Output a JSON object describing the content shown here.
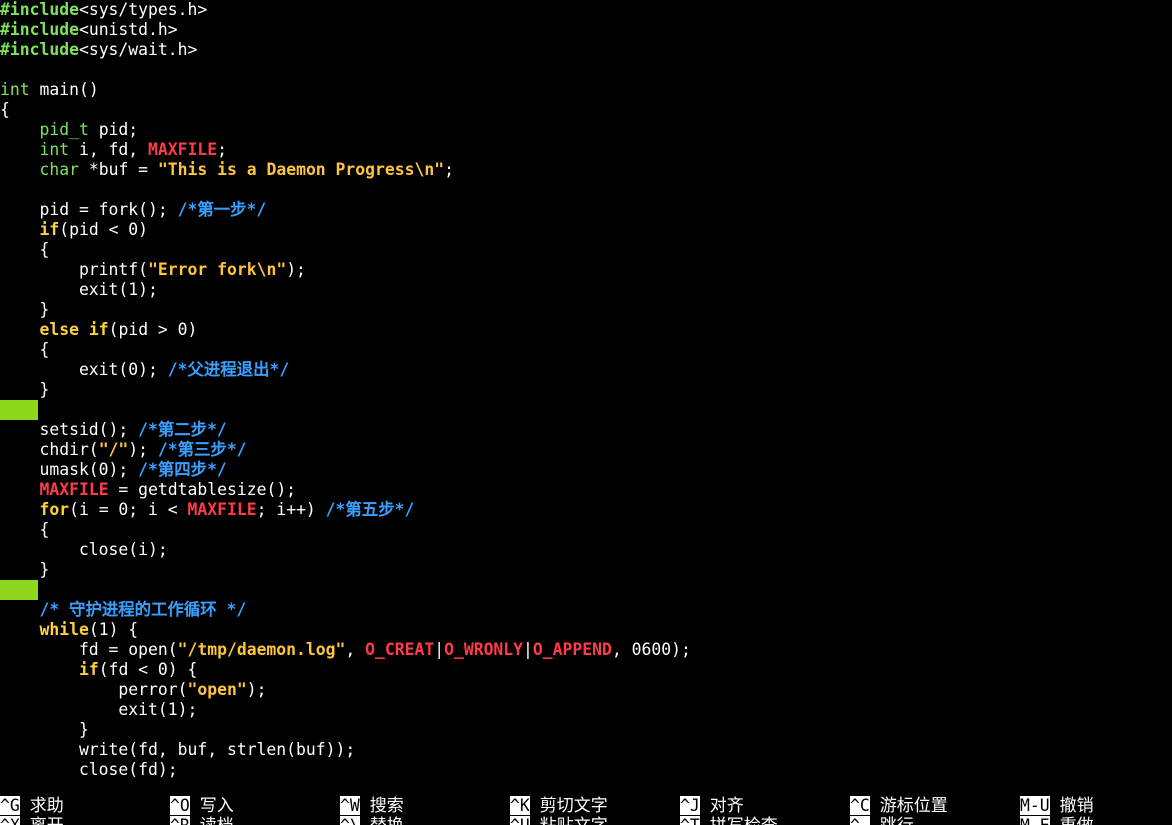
{
  "editor": {
    "lines": [
      {
        "tokens": [
          {
            "t": "#include",
            "c": "pre"
          },
          {
            "t": "<sys/types.h>",
            "c": "plain"
          }
        ]
      },
      {
        "tokens": [
          {
            "t": "#include",
            "c": "pre"
          },
          {
            "t": "<unistd.h>",
            "c": "plain"
          }
        ]
      },
      {
        "tokens": [
          {
            "t": "#include",
            "c": "pre"
          },
          {
            "t": "<sys/wait.h>",
            "c": "plain"
          }
        ]
      },
      {
        "tokens": []
      },
      {
        "tokens": [
          {
            "t": "int",
            "c": "type"
          },
          {
            "t": " main()",
            "c": "plain"
          }
        ]
      },
      {
        "tokens": [
          {
            "t": "{",
            "c": "plain"
          }
        ]
      },
      {
        "tokens": [
          {
            "t": "    ",
            "c": "plain"
          },
          {
            "t": "pid_t",
            "c": "type"
          },
          {
            "t": " pid;",
            "c": "plain"
          }
        ]
      },
      {
        "tokens": [
          {
            "t": "    ",
            "c": "plain"
          },
          {
            "t": "int",
            "c": "type"
          },
          {
            "t": " i, fd, ",
            "c": "plain"
          },
          {
            "t": "MAXFILE",
            "c": "macro"
          },
          {
            "t": ";",
            "c": "plain"
          }
        ]
      },
      {
        "tokens": [
          {
            "t": "    ",
            "c": "plain"
          },
          {
            "t": "char",
            "c": "type"
          },
          {
            "t": " *buf = ",
            "c": "plain"
          },
          {
            "t": "\"This is a Daemon Progress\\n\"",
            "c": "str"
          },
          {
            "t": ";",
            "c": "plain"
          }
        ]
      },
      {
        "tokens": []
      },
      {
        "tokens": [
          {
            "t": "    pid = fork(); ",
            "c": "plain"
          },
          {
            "t": "/*第一步*/",
            "c": "comment"
          }
        ]
      },
      {
        "tokens": [
          {
            "t": "    ",
            "c": "plain"
          },
          {
            "t": "if",
            "c": "kw"
          },
          {
            "t": "(pid < 0)",
            "c": "plain"
          }
        ]
      },
      {
        "tokens": [
          {
            "t": "    {",
            "c": "plain"
          }
        ]
      },
      {
        "tokens": [
          {
            "t": "        printf(",
            "c": "plain"
          },
          {
            "t": "\"Error fork\\n\"",
            "c": "str"
          },
          {
            "t": ");",
            "c": "plain"
          }
        ]
      },
      {
        "tokens": [
          {
            "t": "        exit(1);",
            "c": "plain"
          }
        ]
      },
      {
        "tokens": [
          {
            "t": "    }",
            "c": "plain"
          }
        ]
      },
      {
        "tokens": [
          {
            "t": "    ",
            "c": "plain"
          },
          {
            "t": "else",
            "c": "kw"
          },
          {
            "t": " ",
            "c": "plain"
          },
          {
            "t": "if",
            "c": "kw"
          },
          {
            "t": "(pid > 0)",
            "c": "plain"
          }
        ]
      },
      {
        "tokens": [
          {
            "t": "    {",
            "c": "plain"
          }
        ]
      },
      {
        "tokens": [
          {
            "t": "        exit(0); ",
            "c": "plain"
          },
          {
            "t": "/*父进程退出*/",
            "c": "comment"
          }
        ]
      },
      {
        "tokens": [
          {
            "t": "    }",
            "c": "plain"
          }
        ]
      },
      {
        "tokens": [],
        "marker": true
      },
      {
        "tokens": [
          {
            "t": "    setsid(); ",
            "c": "plain"
          },
          {
            "t": "/*第二步*/",
            "c": "comment"
          }
        ]
      },
      {
        "tokens": [
          {
            "t": "    chdir(",
            "c": "plain"
          },
          {
            "t": "\"/\"",
            "c": "str"
          },
          {
            "t": "); ",
            "c": "plain"
          },
          {
            "t": "/*第三步*/",
            "c": "comment"
          }
        ]
      },
      {
        "tokens": [
          {
            "t": "    umask(0); ",
            "c": "plain"
          },
          {
            "t": "/*第四步*/",
            "c": "comment"
          }
        ]
      },
      {
        "tokens": [
          {
            "t": "    ",
            "c": "plain"
          },
          {
            "t": "MAXFILE",
            "c": "macro"
          },
          {
            "t": " = getdtablesize();",
            "c": "plain"
          }
        ]
      },
      {
        "tokens": [
          {
            "t": "    ",
            "c": "plain"
          },
          {
            "t": "for",
            "c": "kw"
          },
          {
            "t": "(i = 0; i < ",
            "c": "plain"
          },
          {
            "t": "MAXFILE",
            "c": "macro"
          },
          {
            "t": "; i++) ",
            "c": "plain"
          },
          {
            "t": "/*第五步*/",
            "c": "comment"
          }
        ]
      },
      {
        "tokens": [
          {
            "t": "    {",
            "c": "plain"
          }
        ]
      },
      {
        "tokens": [
          {
            "t": "        close(i);",
            "c": "plain"
          }
        ]
      },
      {
        "tokens": [
          {
            "t": "    }",
            "c": "plain"
          }
        ]
      },
      {
        "tokens": [],
        "marker": true
      },
      {
        "tokens": [
          {
            "t": "    ",
            "c": "plain"
          },
          {
            "t": "/* 守护进程的工作循环 */",
            "c": "comment"
          }
        ]
      },
      {
        "tokens": [
          {
            "t": "    ",
            "c": "plain"
          },
          {
            "t": "while",
            "c": "kw"
          },
          {
            "t": "(1) {",
            "c": "plain"
          }
        ]
      },
      {
        "tokens": [
          {
            "t": "        fd = open(",
            "c": "plain"
          },
          {
            "t": "\"/tmp/daemon.log\"",
            "c": "str"
          },
          {
            "t": ", ",
            "c": "plain"
          },
          {
            "t": "O_CREAT",
            "c": "macro"
          },
          {
            "t": "|",
            "c": "plain"
          },
          {
            "t": "O_WRONLY",
            "c": "macro"
          },
          {
            "t": "|",
            "c": "plain"
          },
          {
            "t": "O_APPEND",
            "c": "macro"
          },
          {
            "t": ", 0600);",
            "c": "plain"
          }
        ]
      },
      {
        "tokens": [
          {
            "t": "        ",
            "c": "plain"
          },
          {
            "t": "if",
            "c": "kw"
          },
          {
            "t": "(fd < 0) {",
            "c": "plain"
          }
        ]
      },
      {
        "tokens": [
          {
            "t": "            perror(",
            "c": "plain"
          },
          {
            "t": "\"open\"",
            "c": "str"
          },
          {
            "t": ");",
            "c": "plain"
          }
        ]
      },
      {
        "tokens": [
          {
            "t": "            exit(1);",
            "c": "plain"
          }
        ]
      },
      {
        "tokens": [
          {
            "t": "        }",
            "c": "plain"
          }
        ]
      },
      {
        "tokens": [
          {
            "t": "        write(fd, buf, strlen(buf));",
            "c": "plain"
          }
        ]
      },
      {
        "tokens": [
          {
            "t": "        close(fd);",
            "c": "plain"
          }
        ]
      }
    ]
  },
  "shortcuts": {
    "row1": [
      {
        "key": "^G",
        "label": "求助"
      },
      {
        "key": "^O",
        "label": "写入"
      },
      {
        "key": "^W",
        "label": "搜索"
      },
      {
        "key": "^K",
        "label": "剪切文字"
      },
      {
        "key": "^J",
        "label": "对齐"
      },
      {
        "key": "^C",
        "label": "游标位置"
      },
      {
        "key": "M-U",
        "label": "撤销"
      }
    ],
    "row2": [
      {
        "key": "^X",
        "label": "离开"
      },
      {
        "key": "^R",
        "label": "读档"
      },
      {
        "key": "^\\",
        "label": "替换"
      },
      {
        "key": "^U",
        "label": "粘贴文字"
      },
      {
        "key": "^T",
        "label": "拼写检查"
      },
      {
        "key": "^_",
        "label": "跳行"
      },
      {
        "key": "M-E",
        "label": "重做"
      }
    ]
  },
  "colors": {
    "background": "#000000",
    "preprocessor": "#7ee35a",
    "type": "#7ee35a",
    "keyword": "#ffd23c",
    "string": "#ffc53b",
    "macro": "#ff3b4a",
    "comment": "#3aa0ff",
    "whitespace_marker": "#8fd71c"
  }
}
